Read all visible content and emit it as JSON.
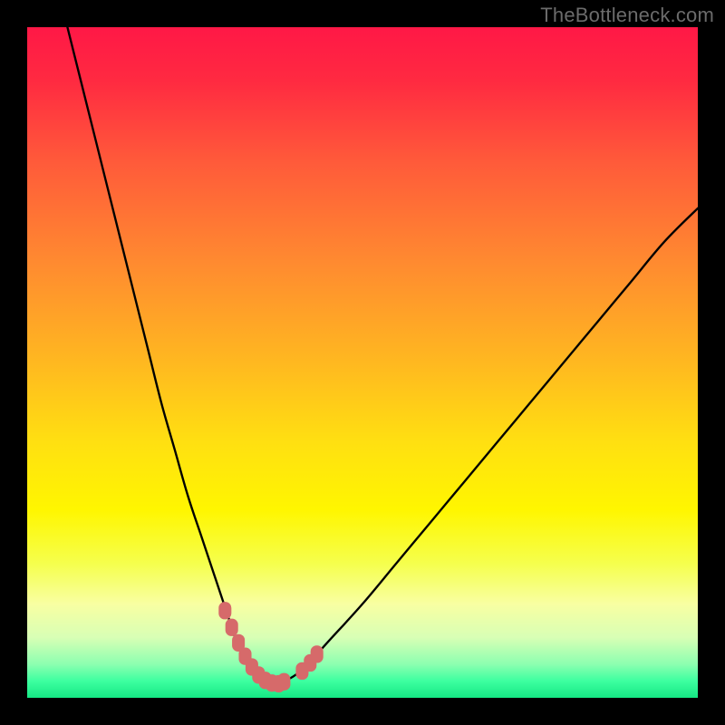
{
  "watermark": "TheBottleneck.com",
  "colors": {
    "frame": "#000000",
    "gradient_stops": [
      {
        "offset": 0.0,
        "color": "#ff1846"
      },
      {
        "offset": 0.08,
        "color": "#ff2a41"
      },
      {
        "offset": 0.2,
        "color": "#ff5a3a"
      },
      {
        "offset": 0.35,
        "color": "#ff8a30"
      },
      {
        "offset": 0.5,
        "color": "#ffb820"
      },
      {
        "offset": 0.62,
        "color": "#ffe011"
      },
      {
        "offset": 0.72,
        "color": "#fff600"
      },
      {
        "offset": 0.8,
        "color": "#f5ff4d"
      },
      {
        "offset": 0.86,
        "color": "#f8ffa2"
      },
      {
        "offset": 0.91,
        "color": "#d8ffb5"
      },
      {
        "offset": 0.95,
        "color": "#8cffb0"
      },
      {
        "offset": 0.975,
        "color": "#3dffa0"
      },
      {
        "offset": 1.0,
        "color": "#15e884"
      }
    ],
    "curve": "#000000",
    "markers": "#d66a6a"
  },
  "chart_data": {
    "type": "line",
    "title": "",
    "xlabel": "",
    "ylabel": "",
    "xlim": [
      0,
      100
    ],
    "ylim": [
      0,
      100
    ],
    "series": [
      {
        "name": "bottleneck-curve",
        "x": [
          6,
          8,
          10,
          12,
          14,
          16,
          18,
          20,
          22,
          24,
          26,
          28,
          30,
          31,
          32,
          33,
          34,
          35,
          36,
          37,
          38,
          40,
          42,
          45,
          50,
          55,
          60,
          65,
          70,
          75,
          80,
          85,
          90,
          95,
          100
        ],
        "y": [
          100,
          92,
          84,
          76,
          68,
          60,
          52,
          44,
          37,
          30,
          24,
          18,
          12,
          9,
          6.5,
          4.5,
          3.2,
          2.4,
          2.0,
          2.0,
          2.3,
          3.4,
          5.2,
          8.5,
          14,
          20,
          26,
          32,
          38,
          44,
          50,
          56,
          62,
          68,
          73
        ]
      }
    ],
    "markers": {
      "name": "highlighted-points",
      "x": [
        29.5,
        30.5,
        31.5,
        32.5,
        33.5,
        34.5,
        35.5,
        36.5,
        37.5,
        38.3,
        41.0,
        42.2,
        43.2
      ],
      "y": [
        13.0,
        10.5,
        8.2,
        6.2,
        4.6,
        3.4,
        2.6,
        2.2,
        2.1,
        2.4,
        4.0,
        5.2,
        6.5
      ]
    }
  }
}
